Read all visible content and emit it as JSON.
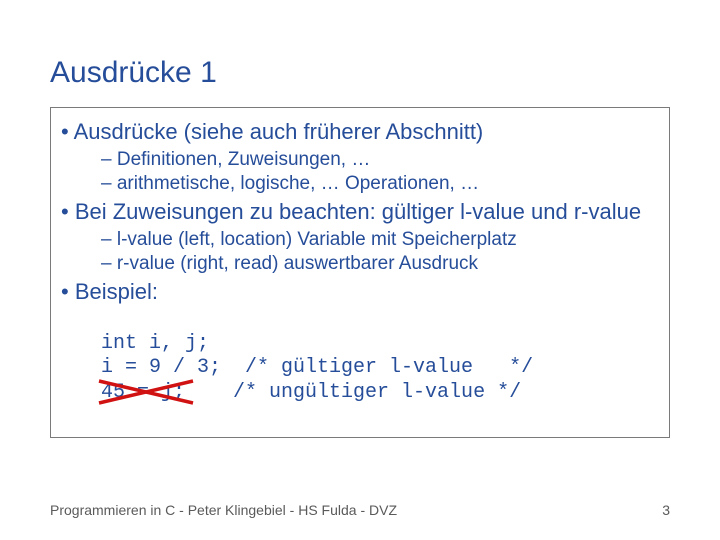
{
  "slide": {
    "title": "Ausdrücke 1",
    "items": [
      {
        "level": 1,
        "text": "Ausdrücke (siehe auch früherer Abschnitt)"
      },
      {
        "level": 2,
        "text": "Definitionen, Zuweisungen, …"
      },
      {
        "level": 2,
        "text": "arithmetische, logische, … Operationen, …"
      },
      {
        "level": 1,
        "text": "Bei Zuweisungen zu beachten: gültiger l-value und r-value"
      },
      {
        "level": 2,
        "text": "l-value (left, location) Variable mit Speicherplatz"
      },
      {
        "level": 2,
        "text": "r-value (right, read) auswertbarer Ausdruck"
      },
      {
        "level": 1,
        "text": "Beispiel:"
      }
    ],
    "code": {
      "line1": "int i, j;",
      "line2": "i = 9 / 3;  /* gültiger l-value   */",
      "line3_strike": "45 = j;",
      "line3_rest": "    /* ungültiger l-value */"
    },
    "footer": "Programmieren in C - Peter Klingebiel - HS Fulda - DVZ",
    "page_number": "3"
  }
}
